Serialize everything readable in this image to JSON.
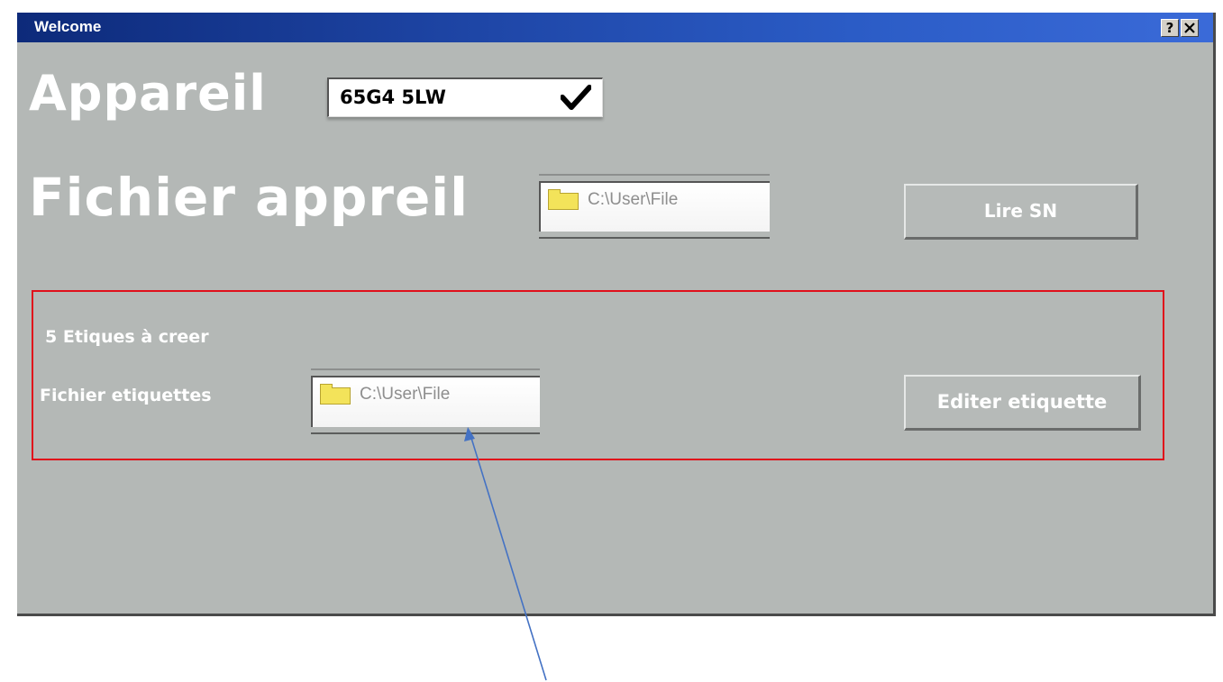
{
  "window": {
    "title": "Welcome",
    "help_button": "?",
    "close_button": "✕"
  },
  "device": {
    "label": "Appareil",
    "value": "65G4 5LW",
    "check_icon": "checkmark-icon"
  },
  "device_file": {
    "label": "Fichier appreil",
    "path": "C:\\User\\File",
    "icon": "folder-icon"
  },
  "read_sn_button": {
    "label": "Lire SN"
  },
  "labels_section": {
    "count_text": "5 Etiques à creer",
    "file_label": "Fichier etiquettes",
    "file_path": "C:\\User\\File",
    "file_icon": "folder-icon",
    "edit_button": "Editer etiquette",
    "border_color": "#e0101b"
  },
  "annotation": {
    "arrow_color": "#4472c4"
  },
  "colors": {
    "title_bar": "#1f47a8",
    "window_bg": "#b4b8b6",
    "label_text": "#ffffff"
  }
}
